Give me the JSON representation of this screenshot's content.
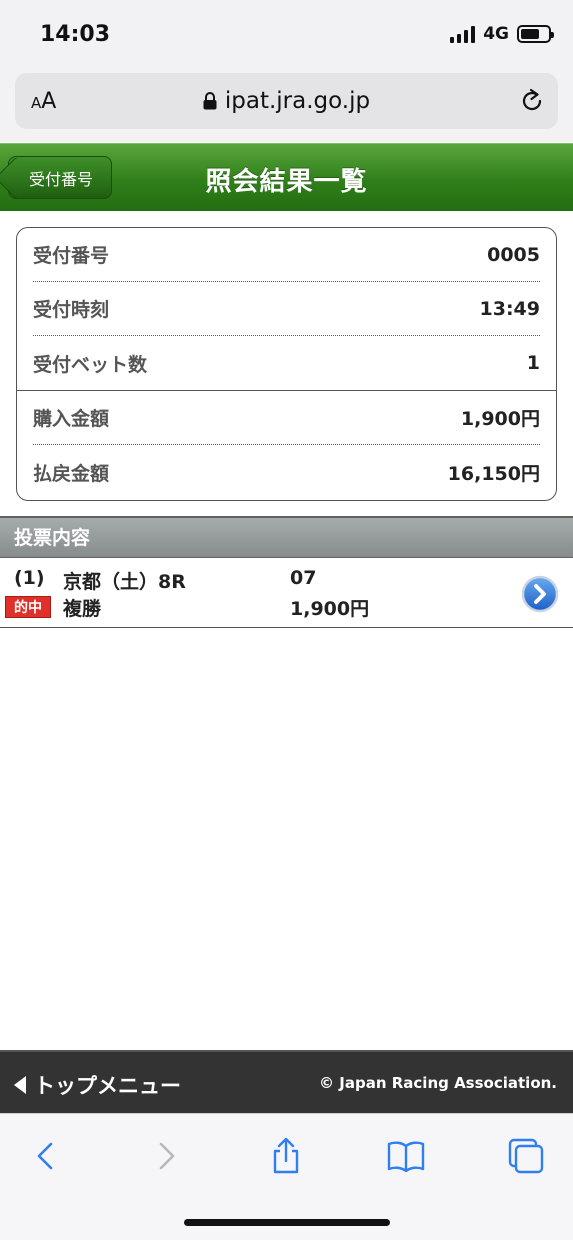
{
  "status_bar": {
    "time": "14:03",
    "network": "4G"
  },
  "browser": {
    "text_size_label": "AA",
    "url": "ipat.jra.go.jp"
  },
  "header": {
    "back_label": "受付番号",
    "title": "照会結果一覧",
    "accent_color": "#2f7f1a"
  },
  "summary": {
    "rows": [
      {
        "label": "受付番号",
        "value": "0005"
      },
      {
        "label": "受付時刻",
        "value": "13:49"
      },
      {
        "label": "受付ベット数",
        "value": "1"
      },
      {
        "label": "購入金額",
        "value": "1,900円"
      },
      {
        "label": "払戻金額",
        "value": "16,150円"
      }
    ]
  },
  "section": {
    "title": "投票内容"
  },
  "votes": [
    {
      "number": "(1)",
      "race": "京都（土）8R",
      "horse": "07",
      "hit_badge": "的中",
      "bet_type": "複勝",
      "amount": "1,900円"
    }
  ],
  "footer": {
    "top_menu": "トップメニュー",
    "copyright": "© Japan Racing Association."
  },
  "icons": {
    "back": "chevron-left-icon",
    "forward": "chevron-right-icon",
    "share": "share-icon",
    "bookmarks": "book-icon",
    "tabs": "tabs-icon",
    "detail": "chevron-circle-right-icon"
  }
}
